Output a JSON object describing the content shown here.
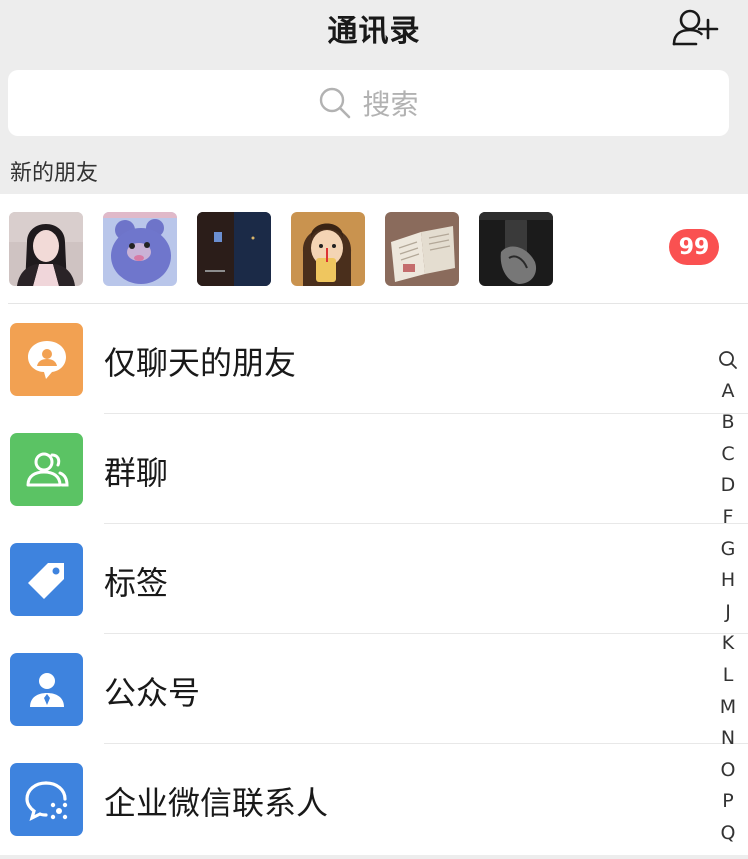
{
  "header": {
    "title": "通讯录",
    "add_icon": "add-friend-icon"
  },
  "search": {
    "placeholder": "搜索",
    "icon": "search-icon"
  },
  "new_friends": {
    "label": "新的朋友",
    "badge": "99",
    "avatars": [
      {
        "name": "girl-portrait",
        "colors": [
          "#cbb7b5",
          "#2a2024",
          "#f0d8d6"
        ]
      },
      {
        "name": "cartoon-bear",
        "colors": [
          "#6b73c9",
          "#a7b6e8",
          "#d6b4c4"
        ]
      },
      {
        "name": "dark-night-scene",
        "colors": [
          "#281c18",
          "#3a4c6e",
          "#16263f"
        ]
      },
      {
        "name": "child-drinking",
        "colors": [
          "#d9a662",
          "#5a3b22",
          "#f1d9a8"
        ]
      },
      {
        "name": "open-book",
        "colors": [
          "#a88670",
          "#e9e2d6",
          "#7c5e50"
        ]
      },
      {
        "name": "dark-hands",
        "colors": [
          "#1e1e1e",
          "#555",
          "#8a8a8a"
        ]
      }
    ]
  },
  "menu": [
    {
      "label": "仅聊天的朋友",
      "icon": "chat-only-friend-icon",
      "color": "#f2a152"
    },
    {
      "label": "群聊",
      "icon": "group-chat-icon",
      "color": "#5bc364"
    },
    {
      "label": "标签",
      "icon": "tag-icon",
      "color": "#3e83de"
    },
    {
      "label": "公众号",
      "icon": "official-account-icon",
      "color": "#3e83de"
    },
    {
      "label": "企业微信联系人",
      "icon": "enterprise-contact-icon",
      "color": "#3e83de"
    }
  ],
  "index_bar": {
    "search_symbol": "search-index-icon",
    "letters": [
      "A",
      "B",
      "C",
      "D",
      "F",
      "G",
      "H",
      "J",
      "K",
      "L",
      "M",
      "N",
      "O",
      "P",
      "Q"
    ]
  }
}
